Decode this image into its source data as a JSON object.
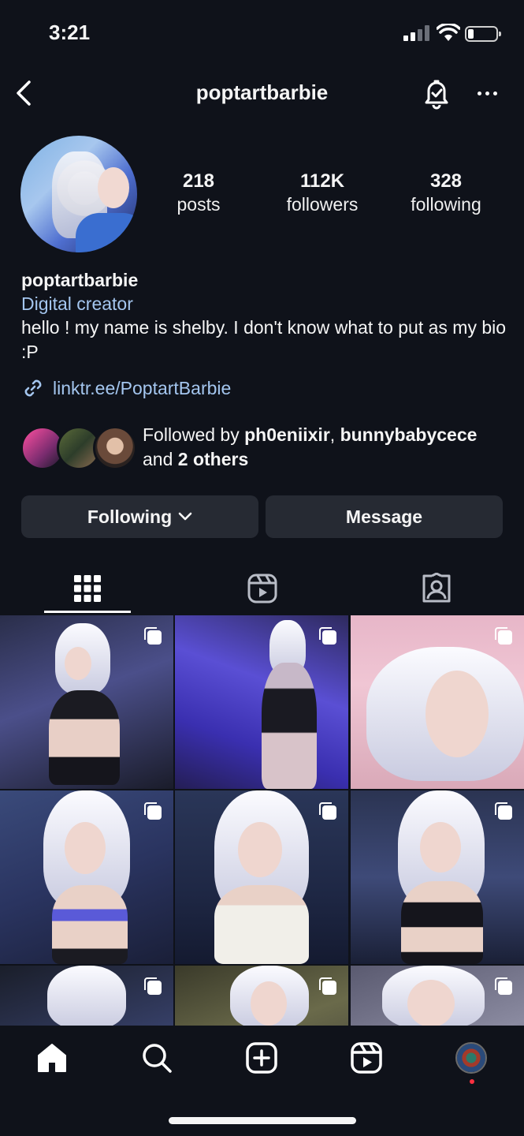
{
  "status_bar": {
    "time": "3:21",
    "battery_level": 0.2
  },
  "header": {
    "username": "poptartbarbie",
    "back_icon": "chevron-left-icon",
    "notification_icon": "bell-check-icon",
    "more_icon": "ellipsis-icon"
  },
  "profile": {
    "stats": [
      {
        "value": "218",
        "label": "posts"
      },
      {
        "value": "112K",
        "label": "followers"
      },
      {
        "value": "328",
        "label": "following"
      }
    ],
    "name": "poptartbarbie",
    "category": "Digital creator",
    "bio": "hello ! my name is shelby. I don't know what to put as my bio :P",
    "link": "linktr.ee/PoptartBarbie"
  },
  "followed_by": {
    "prefix": "Followed by ",
    "user1": "ph0eniixir",
    "separator": ", ",
    "user2": "bunnybabycece",
    "middle": "and ",
    "others": "2 others"
  },
  "actions": {
    "following_label": "Following",
    "message_label": "Message"
  },
  "tabs": [
    "grid-icon",
    "reels-icon",
    "tagged-icon"
  ],
  "bottom_nav": [
    "home-icon",
    "search-icon",
    "create-icon",
    "reels-icon",
    "profile-avatar"
  ],
  "colors": {
    "background": "#0f121a",
    "button": "#262a33",
    "link": "#a4c6ef",
    "notification_dot": "#ff3040"
  }
}
